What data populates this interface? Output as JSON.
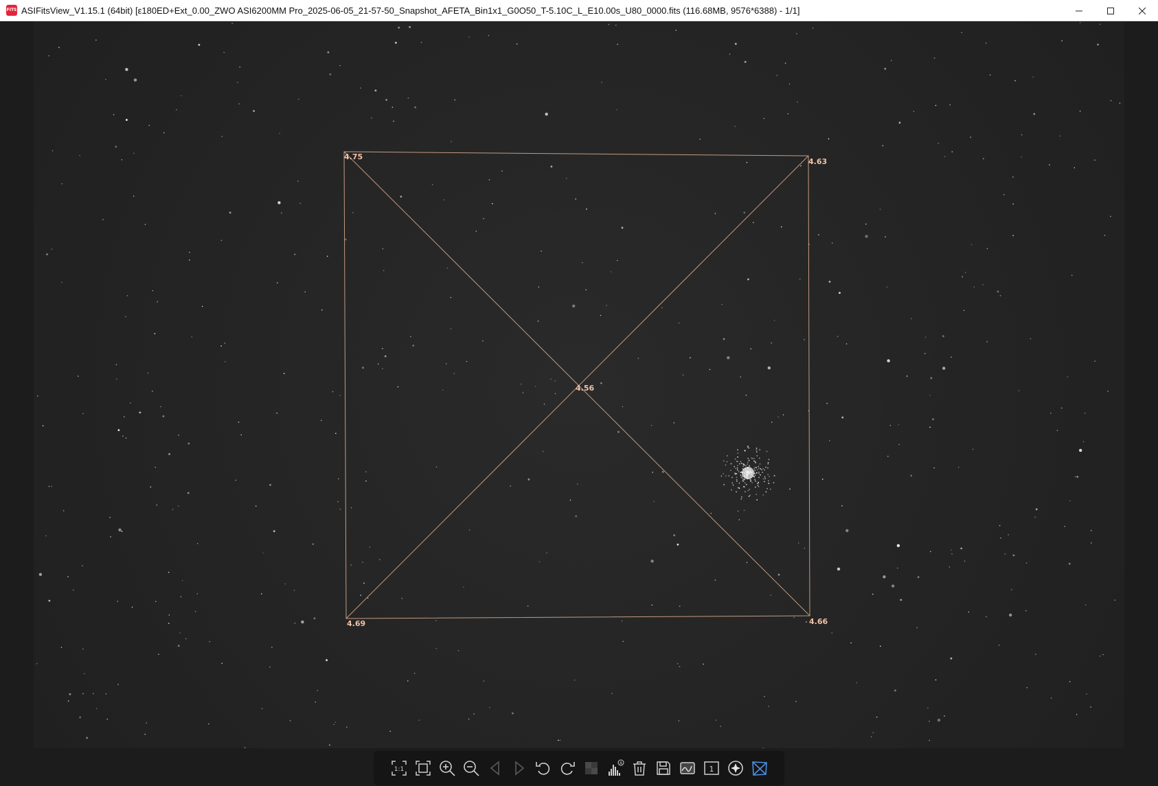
{
  "window": {
    "title": "ASIFitsView_V1.15.1 (64bit) [ε180ED+Ext_0.00_ZWO ASI6200MM Pro_2025-06-05_21-57-50_Snapshot_AFETA_Bin1x1_G0O50_T-5.10C_L_E10.00s_U80_0000.fits (116.68MB, 9576*6388) - 1/1]",
    "app_icon_label": "FITS",
    "controls": [
      "minimize-icon",
      "maximize-icon",
      "close-icon"
    ]
  },
  "overlay": {
    "color": "#d6a88c",
    "fwhm_labels": {
      "top_left": "4.75",
      "top_right": "4.63",
      "center": "4.56",
      "bottom_left": "4.69",
      "bottom_right": "4.66"
    }
  },
  "toolbar": {
    "tools": [
      {
        "name": "actual-size-icon",
        "enabled": true
      },
      {
        "name": "fit-window-icon",
        "enabled": true
      },
      {
        "name": "zoom-in-icon",
        "enabled": true
      },
      {
        "name": "zoom-out-icon",
        "enabled": true
      },
      {
        "name": "previous-icon",
        "enabled": false
      },
      {
        "name": "next-icon",
        "enabled": false
      },
      {
        "name": "rotate-left-icon",
        "enabled": true
      },
      {
        "name": "rotate-right-icon",
        "enabled": true
      },
      {
        "name": "debayer-icon",
        "enabled": false
      },
      {
        "name": "histogram-auto-icon",
        "enabled": true
      },
      {
        "name": "delete-icon",
        "enabled": true
      },
      {
        "name": "save-icon",
        "enabled": true
      },
      {
        "name": "image-info-icon",
        "enabled": true
      },
      {
        "name": "single-view-icon",
        "enabled": true
      },
      {
        "name": "star-detect-icon",
        "enabled": true
      },
      {
        "name": "tilt-analysis-icon",
        "enabled": true,
        "active": true
      }
    ]
  }
}
